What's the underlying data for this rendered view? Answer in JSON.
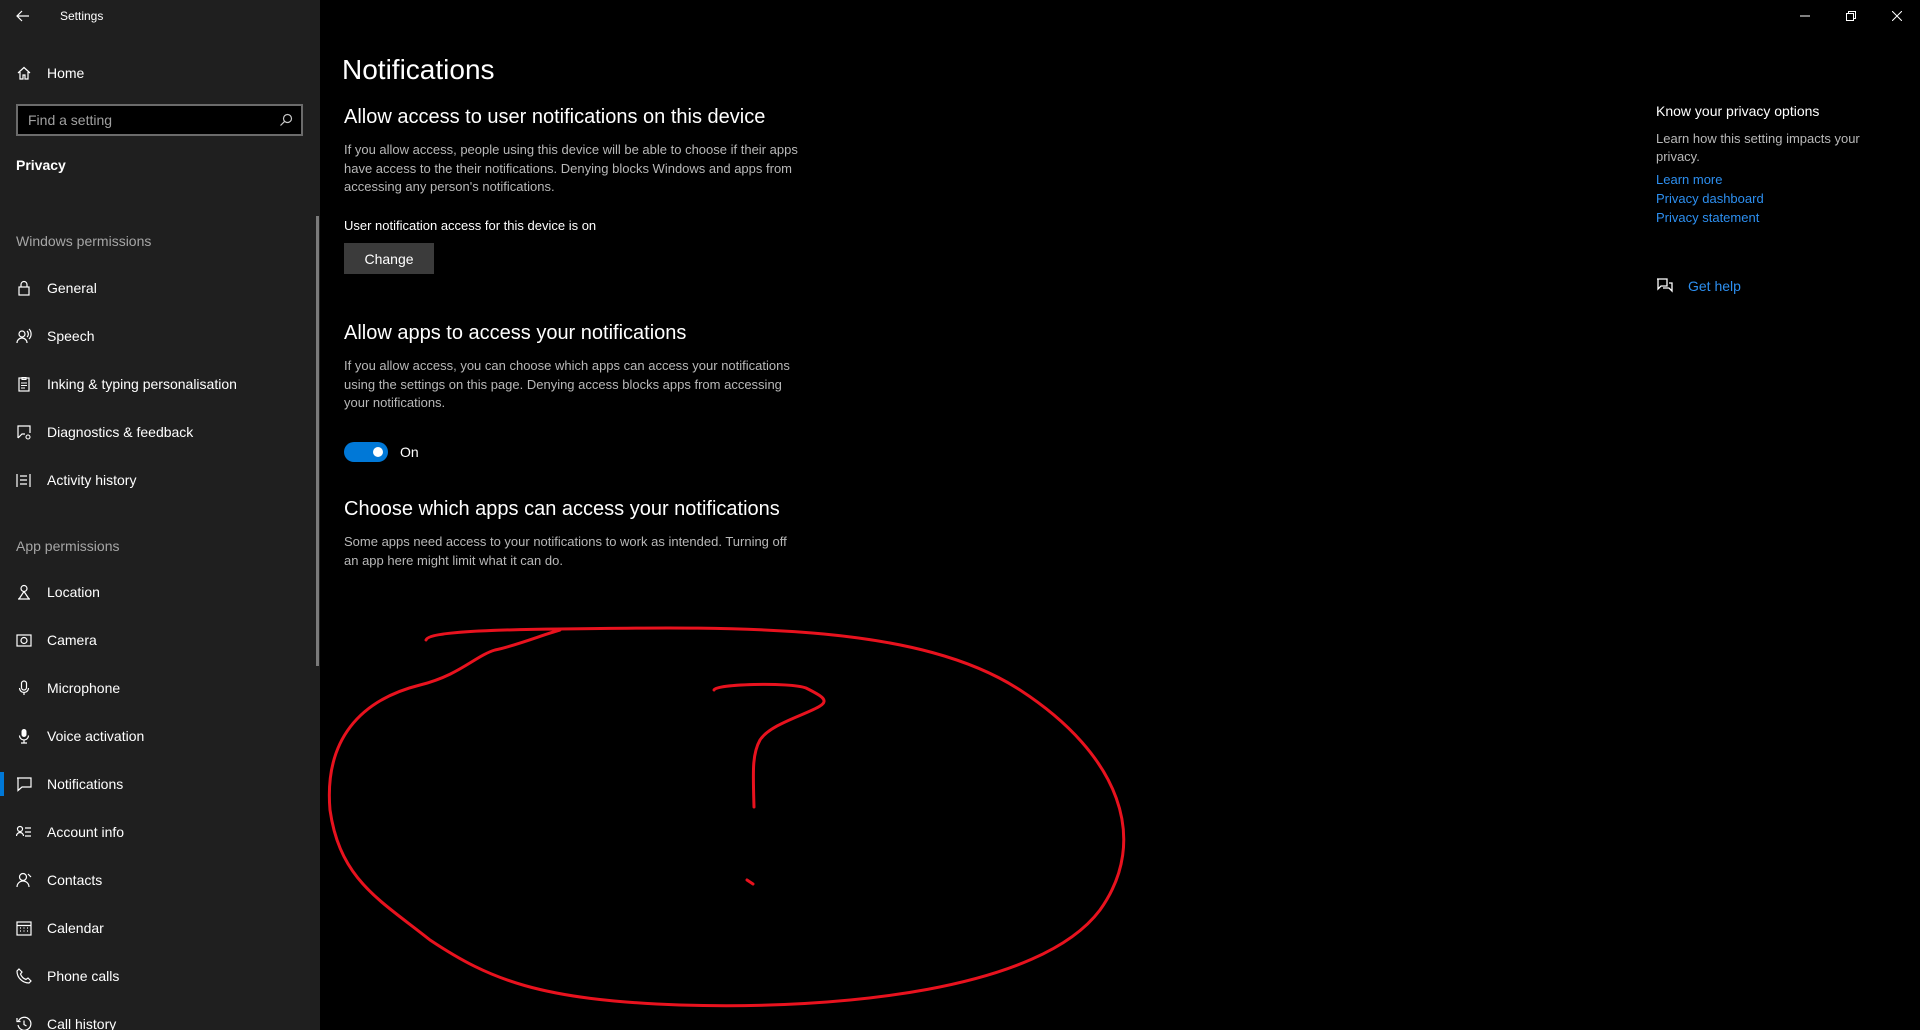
{
  "window": {
    "title": "Settings",
    "controls": [
      "minimize",
      "restore",
      "close"
    ]
  },
  "sidebar": {
    "home_label": "Home",
    "search_placeholder": "Find a setting",
    "section": "Privacy",
    "windows_permissions_label": "Windows permissions",
    "windows_permissions": [
      {
        "label": "General",
        "icon": "lock-icon"
      },
      {
        "label": "Speech",
        "icon": "speech-icon"
      },
      {
        "label": "Inking & typing personalisation",
        "icon": "clipboard-icon"
      },
      {
        "label": "Diagnostics & feedback",
        "icon": "feedback-icon"
      },
      {
        "label": "Activity history",
        "icon": "activity-icon"
      }
    ],
    "app_permissions_label": "App permissions",
    "app_permissions": [
      {
        "label": "Location",
        "icon": "location-icon"
      },
      {
        "label": "Camera",
        "icon": "camera-icon"
      },
      {
        "label": "Microphone",
        "icon": "microphone-icon"
      },
      {
        "label": "Voice activation",
        "icon": "voice-icon"
      },
      {
        "label": "Notifications",
        "icon": "notification-icon",
        "selected": true
      },
      {
        "label": "Account info",
        "icon": "account-info-icon"
      },
      {
        "label": "Contacts",
        "icon": "contacts-icon"
      },
      {
        "label": "Calendar",
        "icon": "calendar-icon"
      },
      {
        "label": "Phone calls",
        "icon": "phone-icon"
      },
      {
        "label": "Call history",
        "icon": "history-icon"
      }
    ]
  },
  "main": {
    "page_title": "Notifications",
    "device_section": {
      "title": "Allow access to user notifications on this device",
      "description": "If you allow access, people using this device will be able to choose if their apps have access to the their notifications. Denying blocks Windows and apps from accessing any person's notifications.",
      "status": "User notification access for this device is on",
      "button": "Change"
    },
    "apps_section": {
      "title": "Allow apps to access your notifications",
      "description": "If you allow access, you can choose which apps can access your notifications using the settings on this page. Denying access blocks apps from accessing your notifications.",
      "toggle_state": "On"
    },
    "choose_section": {
      "title": "Choose which apps can access your notifications",
      "description": "Some apps need access to your notifications to work as intended. Turning off an app here might limit what it can do."
    },
    "annotation_color": "#e8121e"
  },
  "side_panel": {
    "title": "Know your privacy options",
    "description": "Learn how this setting impacts your privacy.",
    "links": [
      "Learn more",
      "Privacy dashboard",
      "Privacy statement"
    ],
    "help": "Get help"
  },
  "colors": {
    "accent": "#0078d7",
    "link": "#2d8ff0",
    "sidebar_bg": "#1f1f1f",
    "content_bg": "#000000"
  }
}
